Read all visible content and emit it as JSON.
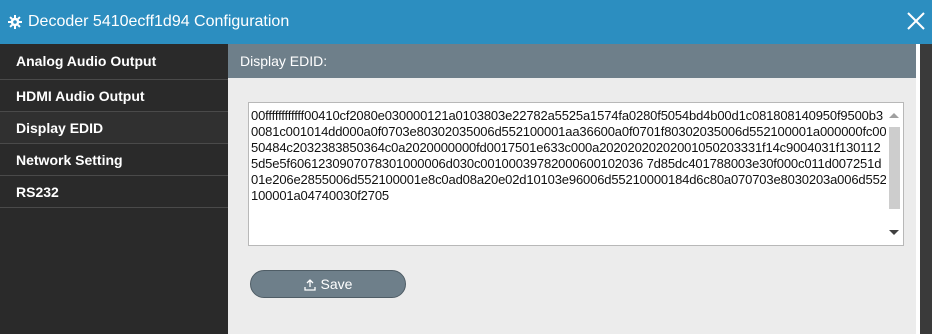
{
  "window": {
    "title": "Decoder 5410ecff1d94 Configuration",
    "gear_icon": "gear-icon",
    "close_icon": "close-icon"
  },
  "sidebar": {
    "items": [
      {
        "label": "Analog Audio Output"
      },
      {
        "label": "HDMI Audio Output"
      },
      {
        "label": "Display EDID"
      },
      {
        "label": "Network Setting"
      },
      {
        "label": "RS232"
      }
    ],
    "active_index": 2
  },
  "main": {
    "section_title": "Display EDID:",
    "edid_value": "00ffffffffffff00410cf2080e030000121a0103803e22782a5525a1574fa0280f5054bd4b00d1c081808140950f9500b30081c001014dd000a0f0703e80302035006d552100001aa36600a0f0701f80302035006d552100001a000000fc0050484c2032383850364c0a2020000000fd0017501e633c000a20202020202001050203331f14c9004031f1301125d5e5f6061230907078301000006d030c00100039782000600102036 7d85dc401788003e30f000c011d007251d01e206e2855006d552100001e8c0ad08a20e02d10103e96006d55210000184d6c80a070703e8030203a006d552100001a04740030f2705",
    "save_label": "Save",
    "save_icon": "upload-icon"
  },
  "colors": {
    "titlebar": "#2c8ec0",
    "sidebar": "#2a2a2a",
    "section_header": "#6e7f8a",
    "content_bg": "#ececec"
  }
}
